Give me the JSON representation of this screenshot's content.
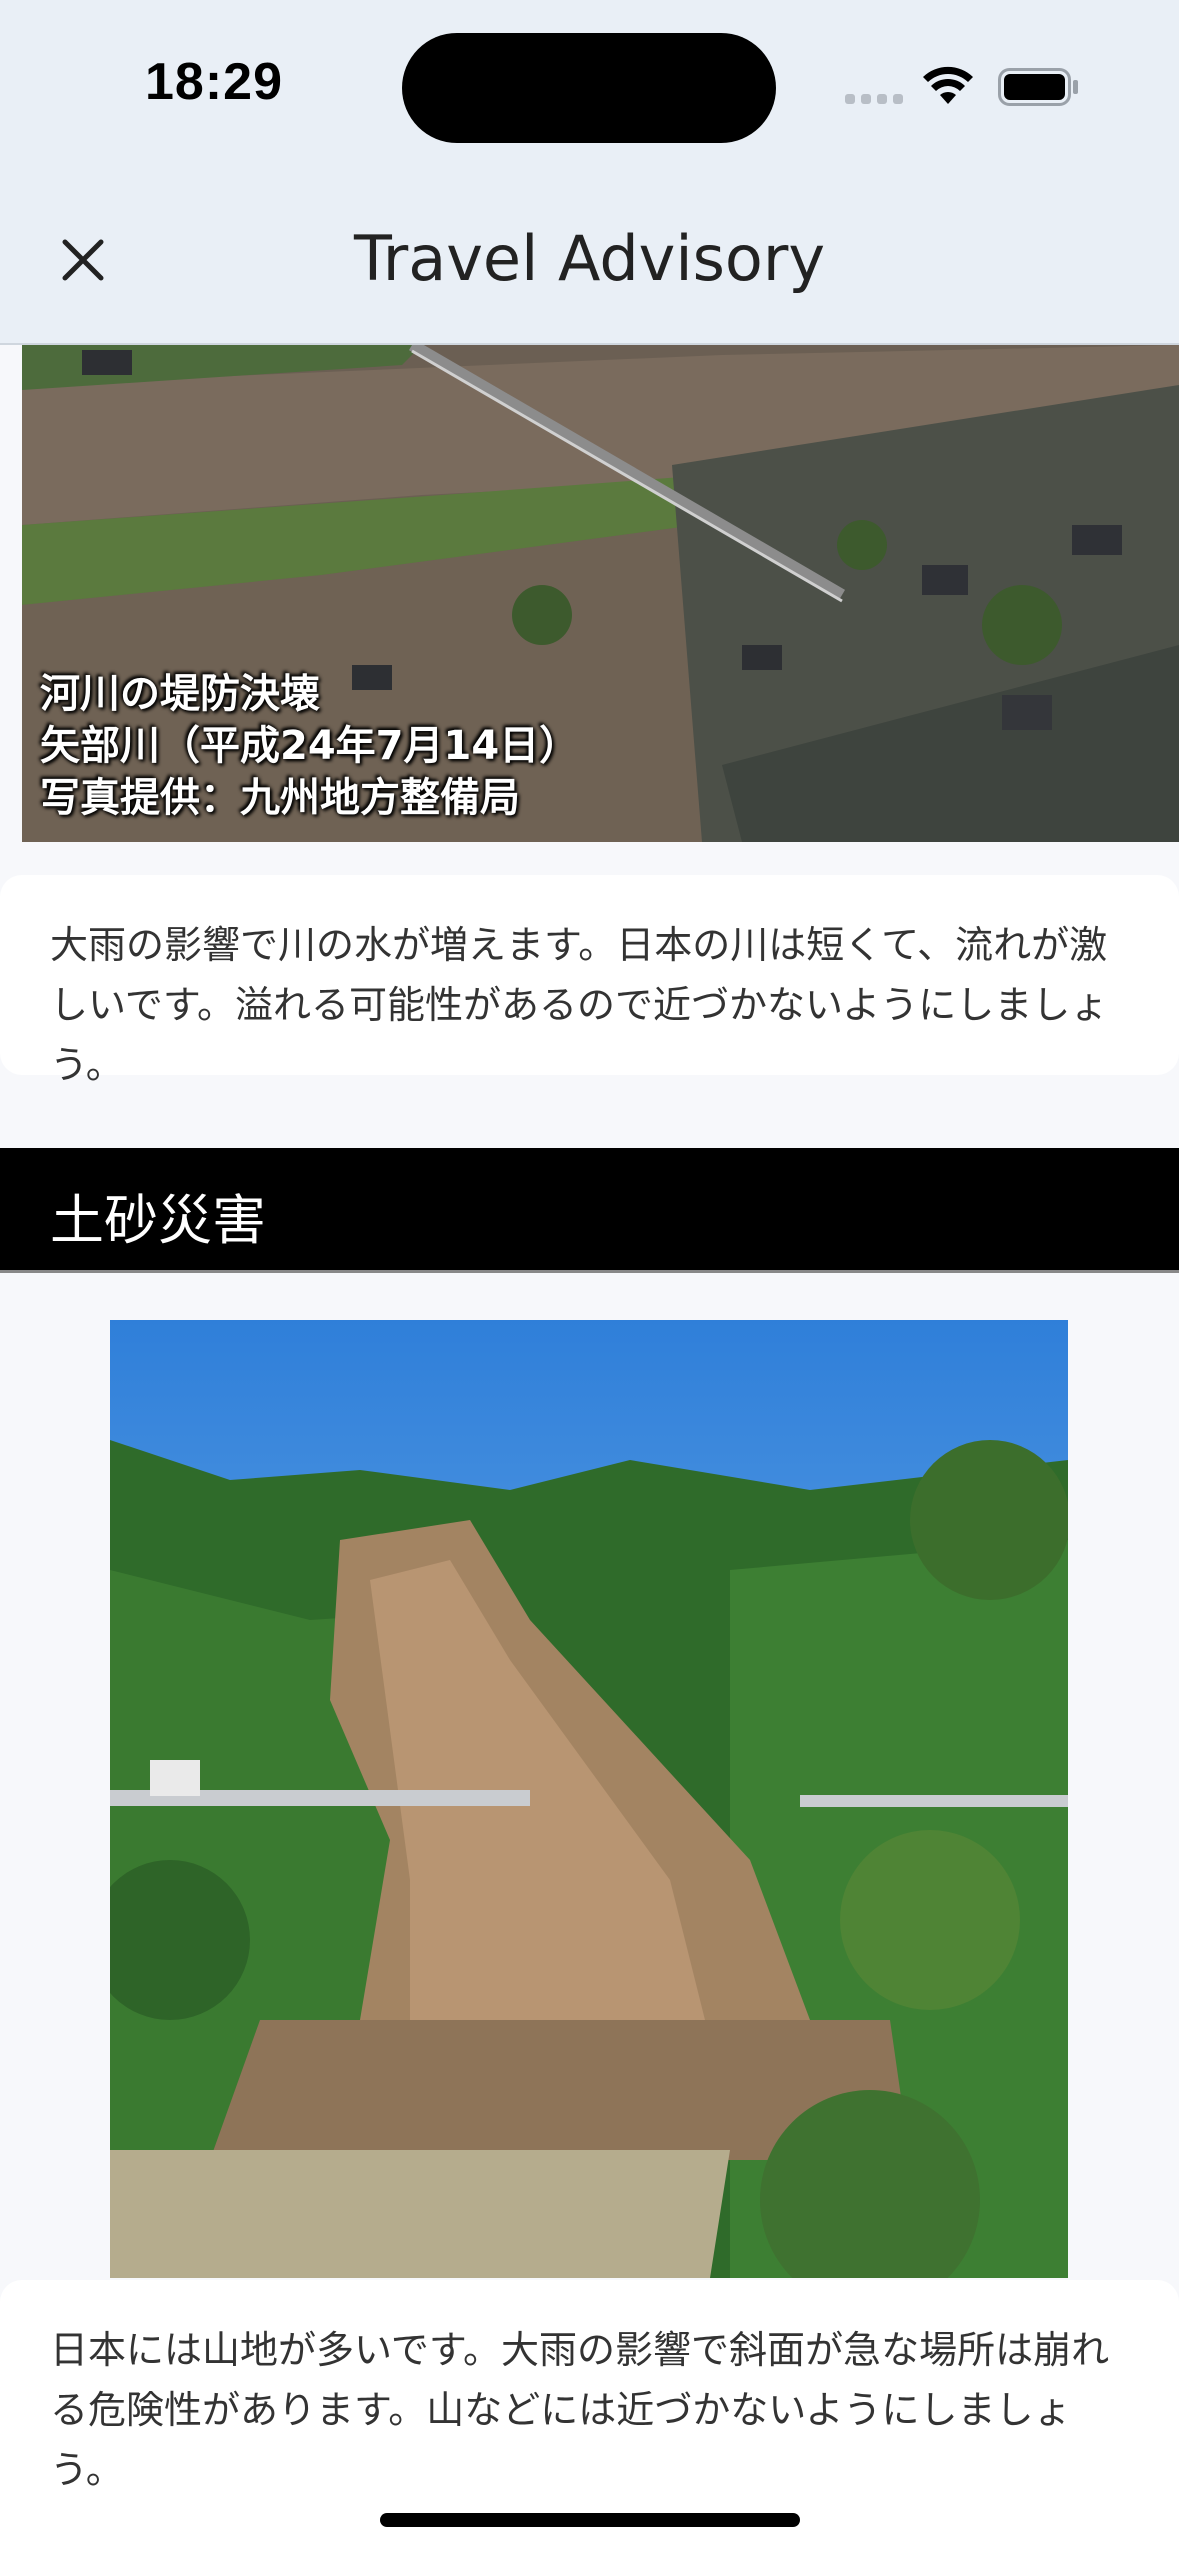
{
  "status_bar": {
    "time": "18:29"
  },
  "nav": {
    "title": "Travel Advisory",
    "close_icon": "close-icon"
  },
  "flood": {
    "caption_lines": [
      "河川の堤防決壊",
      "矢部川（平成24年7月14日）",
      "写真提供：九州地方整備局"
    ],
    "description": "大雨の影響で川の水が増えます。日本の川は短くて、流れが激しいです。溢れる可能性があるので近づかないようにしましょう。"
  },
  "landslide": {
    "heading": "土砂災害",
    "description": "日本には山地が多いです。大雨の影響で斜面が急な場所は崩れる危険性があります。山などには近づかないようにしましょう。"
  },
  "colors": {
    "nav_background": "#e9eff6",
    "section_header": "#000000",
    "content_background": "#f7f8fb"
  }
}
